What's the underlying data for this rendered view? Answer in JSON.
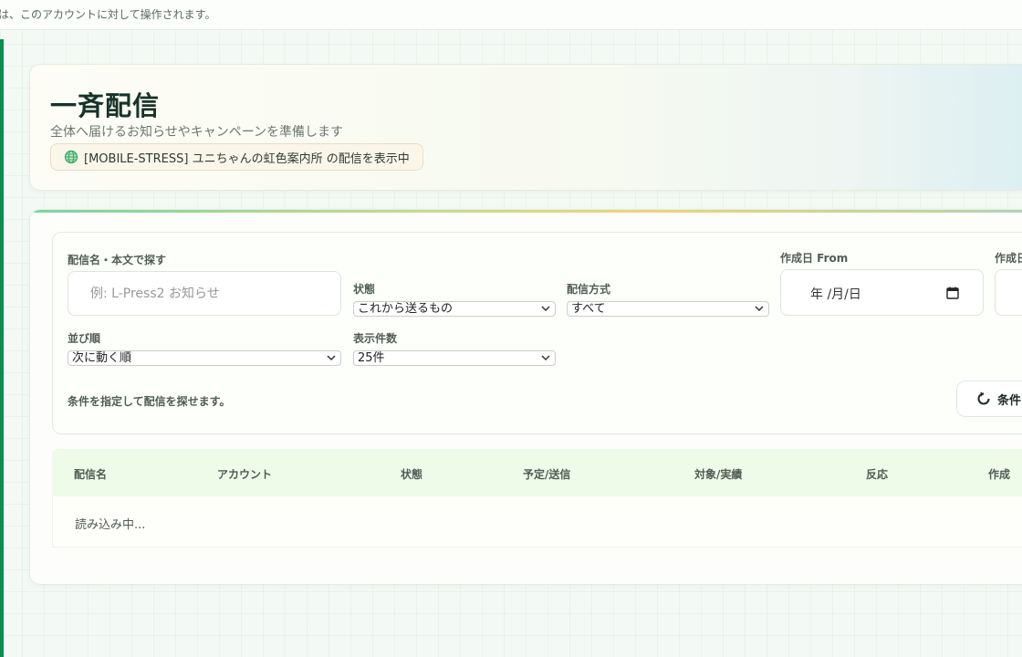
{
  "topbar": {
    "notice": "は、このアカウントに対して操作されます。"
  },
  "header": {
    "title": "一斉配信",
    "subtitle": "全体へ届けるお知らせやキャンペーンを準備します",
    "context_chip": "[MOBILE-STRESS] ユニちゃんの虹色案内所 の配信を表示中",
    "context_icon": "globe-icon"
  },
  "filters": {
    "search_label": "配信名・本文で探す",
    "search_placeholder": "例: L-Press2 お知らせ",
    "search_value": "",
    "status_label": "状態",
    "status_value": "これから送るもの",
    "method_label": "配信方式",
    "method_value": "すべて",
    "date_from_label": "作成日 From",
    "date_from_value": "年 /月/日",
    "date_to_label": "作成日",
    "sort_label": "並び順",
    "sort_value": "次に動く順",
    "count_label": "表示件数",
    "count_value": "25件",
    "hint": "条件を指定して配信を探せます。",
    "reset_label": "条件",
    "reset_icon": "refresh-icon"
  },
  "table": {
    "columns": [
      "配信名",
      "アカウント",
      "状態",
      "予定/送信",
      "対象/実績",
      "反応",
      "作成"
    ],
    "loading_text": "読み込み中..."
  },
  "colors": {
    "accent": "#0b8f4c",
    "title": "#17332a",
    "table_header_bg": "#effbe9"
  }
}
